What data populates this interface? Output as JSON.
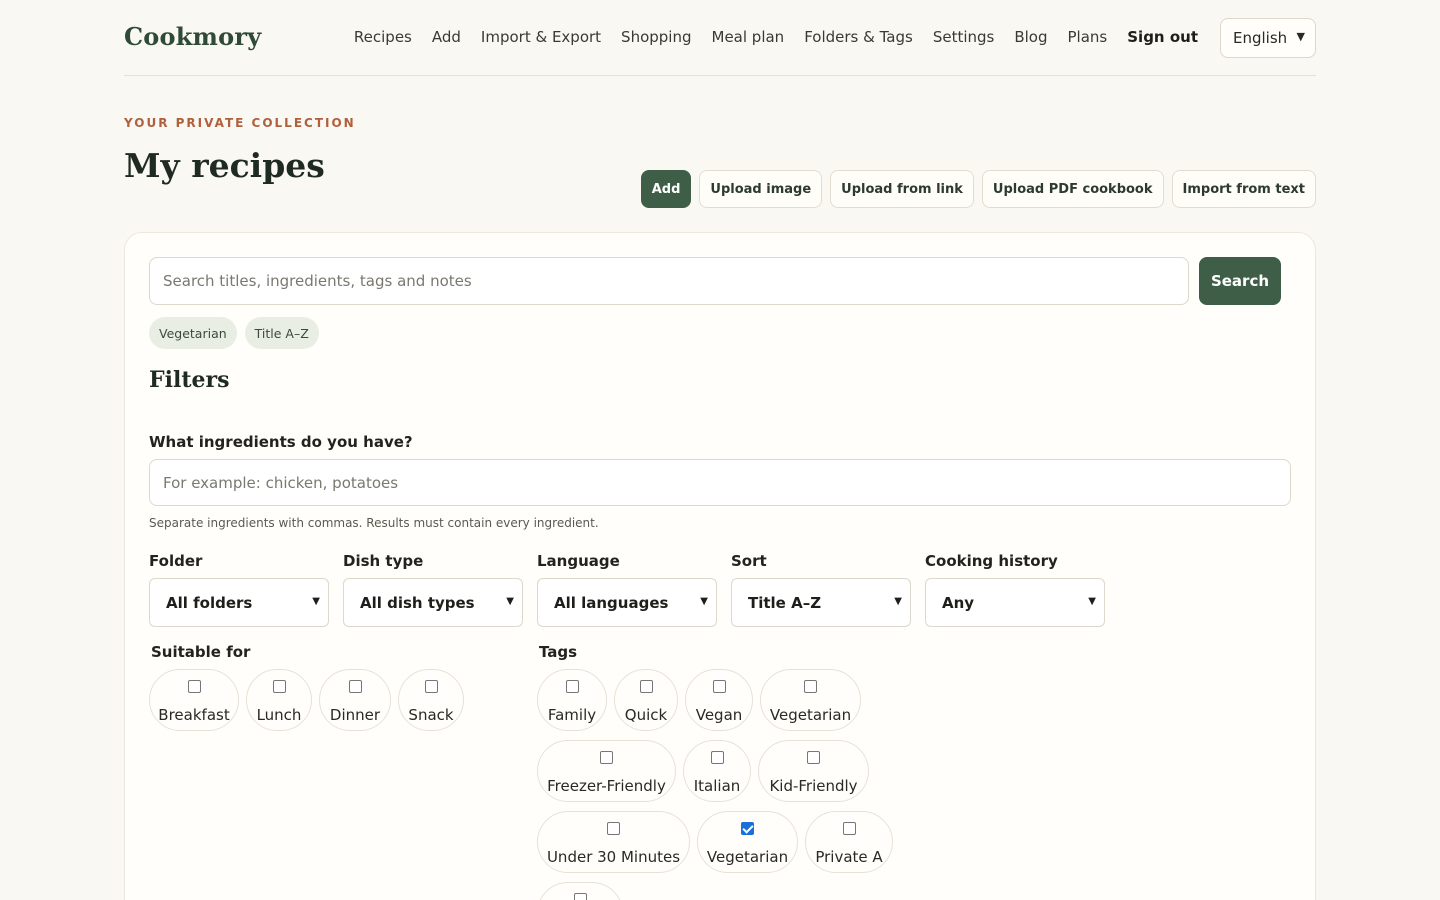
{
  "brand": "Cookmory",
  "nav": [
    "Recipes",
    "Add",
    "Import & Export",
    "Shopping",
    "Meal plan",
    "Folders & Tags",
    "Settings",
    "Blog",
    "Plans"
  ],
  "signout": "Sign out",
  "language_select": "English",
  "eyebrow": "YOUR PRIVATE COLLECTION",
  "page_title": "My recipes",
  "actions": [
    "Add",
    "Upload image",
    "Upload from link",
    "Upload PDF cookbook",
    "Import from text"
  ],
  "search": {
    "placeholder": "Search titles, ingredients, tags and notes",
    "button": "Search"
  },
  "active_chips": [
    "Vegetarian",
    "Title A–Z"
  ],
  "filters": {
    "heading": "Filters",
    "ingredients_label": "What ingredients do you have?",
    "ingredients_placeholder": "For example: chicken, potatoes",
    "ingredients_hint": "Separate ingredients with commas. Results must contain every ingredient.",
    "selects": [
      {
        "label": "Folder",
        "value": "All folders"
      },
      {
        "label": "Dish type",
        "value": "All dish types"
      },
      {
        "label": "Language",
        "value": "All languages"
      },
      {
        "label": "Sort",
        "value": "Title A–Z"
      },
      {
        "label": "Cooking history",
        "value": "Any"
      }
    ],
    "suitable_label": "Suitable for",
    "suitable": [
      {
        "label": "Breakfast",
        "checked": false
      },
      {
        "label": "Lunch",
        "checked": false
      },
      {
        "label": "Dinner",
        "checked": false
      },
      {
        "label": "Snack",
        "checked": false
      }
    ],
    "tags_label": "Tags",
    "tags": [
      {
        "label": "Family",
        "checked": false
      },
      {
        "label": "Quick",
        "checked": false
      },
      {
        "label": "Vegan",
        "checked": false
      },
      {
        "label": "Vegetarian",
        "checked": false
      },
      {
        "label": "Freezer-Friendly",
        "checked": false
      },
      {
        "label": "Italian",
        "checked": false
      },
      {
        "label": "Kid-Friendly",
        "checked": false
      },
      {
        "label": "Under 30 Minutes",
        "checked": false
      },
      {
        "label": "Vegetarian",
        "checked": true
      },
      {
        "label": "Private A",
        "checked": false
      },
      {
        "label": "",
        "checked": false
      }
    ]
  },
  "colors": {
    "accent": "#3f5e47",
    "eyebrow": "#b0603c",
    "background": "#faf8f2"
  },
  "icons": {
    "select": "chevron-down-icon"
  }
}
